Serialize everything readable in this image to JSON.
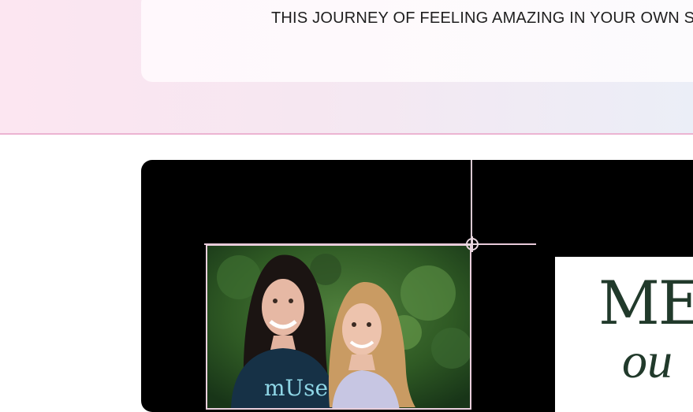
{
  "hero": {
    "tagline": "THIS JOURNEY OF FEELING AMAZING IN YOUR OWN SK"
  },
  "media": {
    "photo_alt_icon": "photo-two-women-icon",
    "shirt_text": "mUse",
    "title_fragment": "MER",
    "script_fragment": "ou"
  },
  "colors": {
    "band_pink": "#fce6f1",
    "band_blue": "#ebeef7",
    "accent_pink": "#ecb4d2",
    "title_green": "#213a2b"
  }
}
